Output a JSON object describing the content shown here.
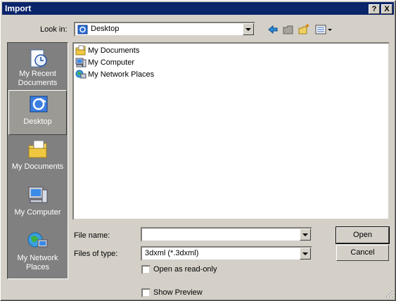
{
  "window": {
    "title": "Import",
    "help_label": "?",
    "close_label": "X"
  },
  "look_in": {
    "label": "Look in:",
    "value": "Desktop"
  },
  "places": [
    {
      "label": "My Recent Documents",
      "icon": "recent-documents-icon"
    },
    {
      "label": "Desktop",
      "icon": "desktop-icon",
      "selected": true
    },
    {
      "label": "My Documents",
      "icon": "my-documents-icon"
    },
    {
      "label": "My Computer",
      "icon": "my-computer-icon"
    },
    {
      "label": "My Network Places",
      "icon": "network-places-icon"
    }
  ],
  "files": [
    {
      "name": "My Documents",
      "icon": "folder-icon"
    },
    {
      "name": "My Computer",
      "icon": "computer-icon"
    },
    {
      "name": "My Network Places",
      "icon": "network-icon"
    }
  ],
  "file_name": {
    "label": "File name:",
    "value": ""
  },
  "files_of_type": {
    "label": "Files of type:",
    "value": "3dxml (*.3dxml)"
  },
  "open_readonly": {
    "label": "Open as read-only",
    "checked": false
  },
  "show_preview": {
    "label": "Show Preview",
    "checked": false
  },
  "buttons": {
    "open": "Open",
    "cancel": "Cancel"
  }
}
